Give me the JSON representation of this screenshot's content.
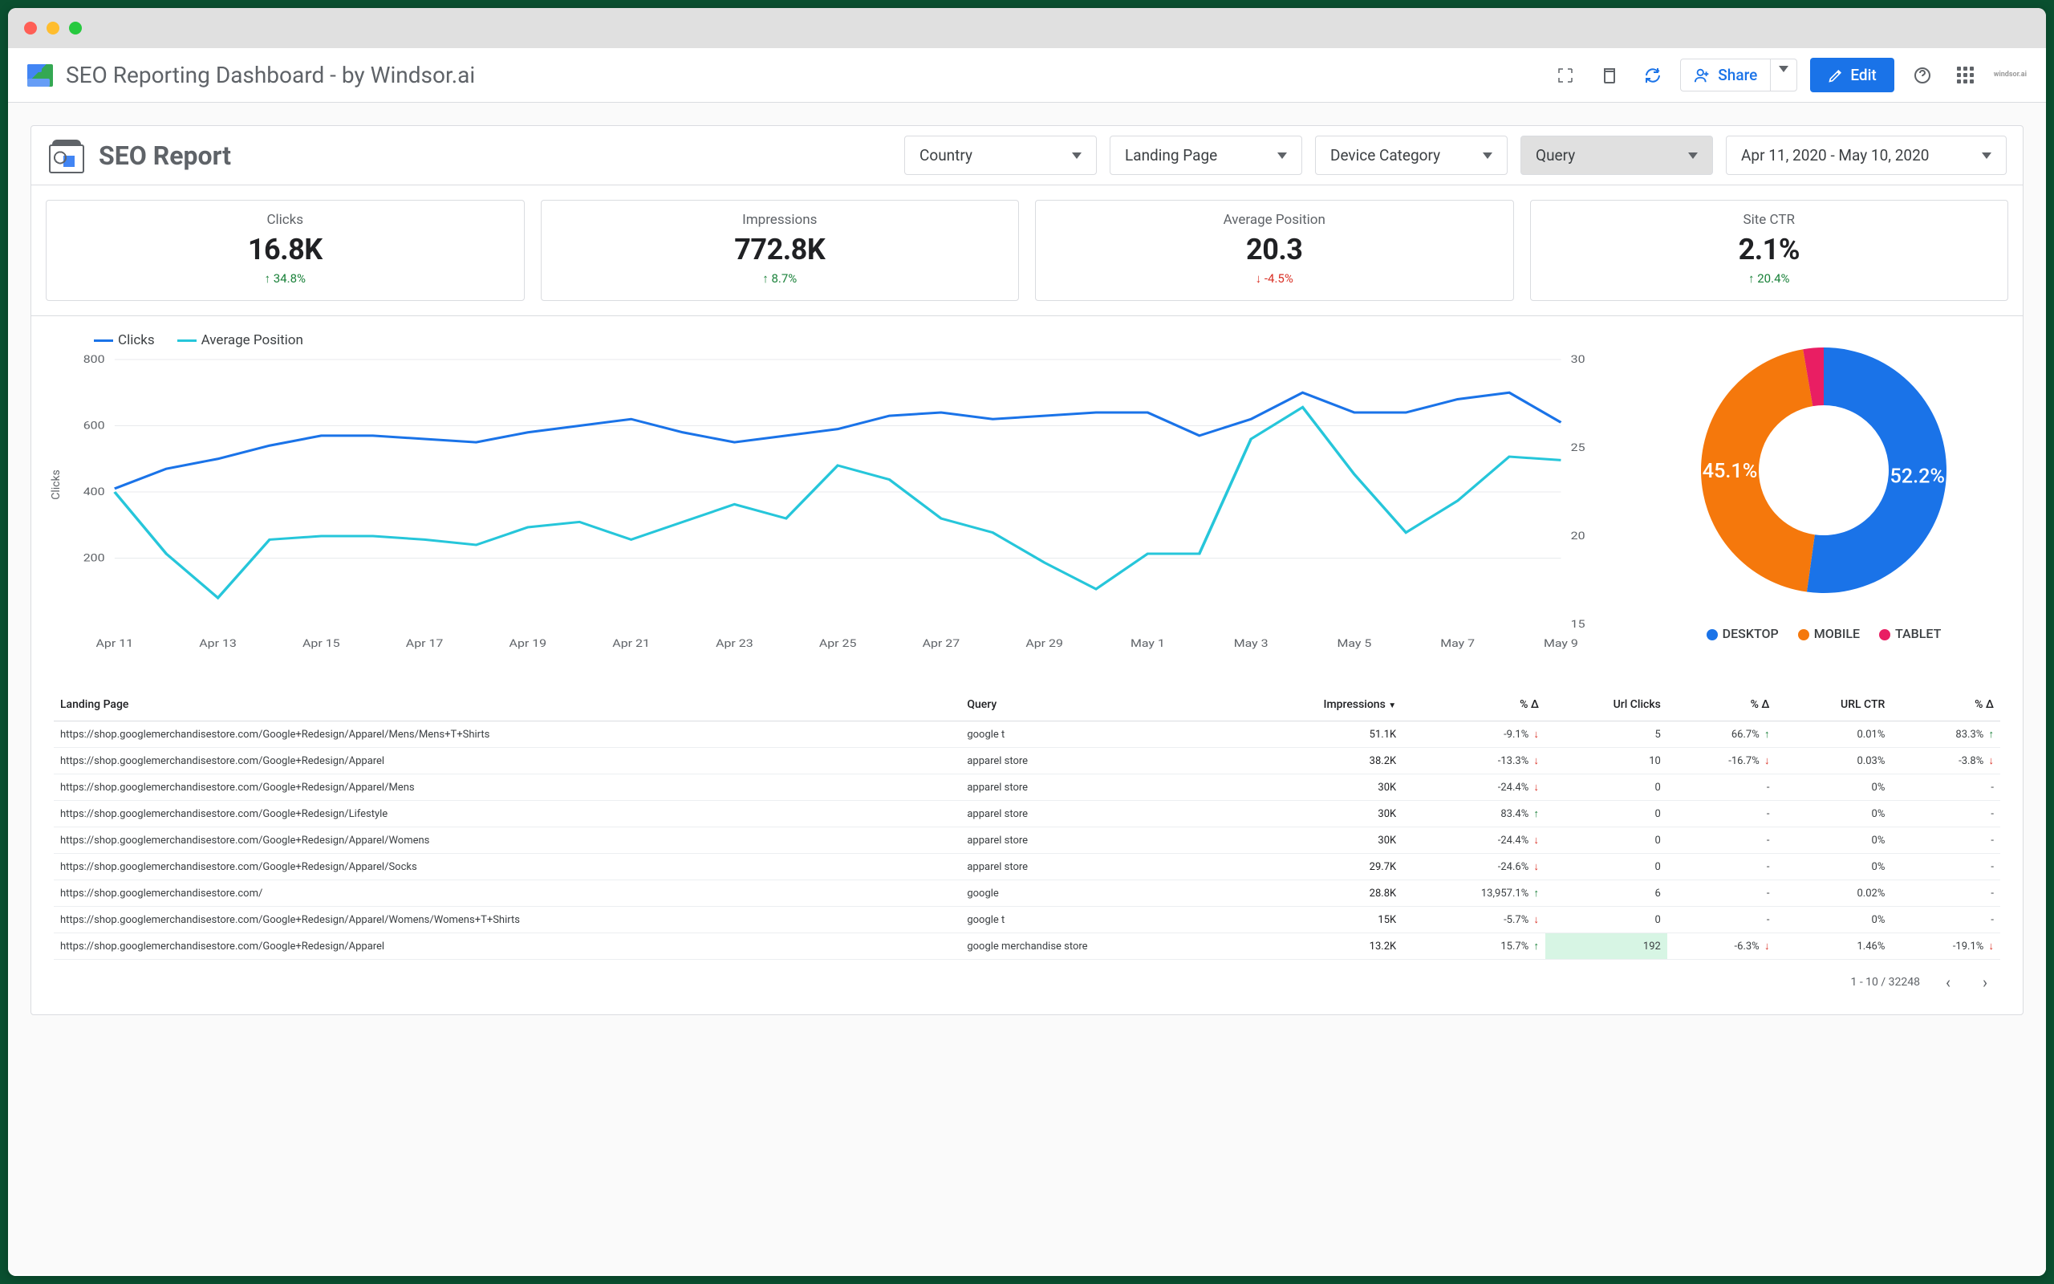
{
  "header": {
    "title": "SEO Reporting Dashboard - by Windsor.ai",
    "share_label": "Share",
    "edit_label": "Edit",
    "brand": "windsor.ai"
  },
  "report": {
    "title": "SEO Report",
    "filters": {
      "country": "Country",
      "landing_page": "Landing Page",
      "device": "Device Category",
      "query": "Query"
    },
    "date_range": "Apr 11, 2020 - May 10, 2020"
  },
  "kpis": [
    {
      "label": "Clicks",
      "value": "16.8K",
      "delta": "34.8%",
      "direction": "up"
    },
    {
      "label": "Impressions",
      "value": "772.8K",
      "delta": "8.7%",
      "direction": "up"
    },
    {
      "label": "Average Position",
      "value": "20.3",
      "delta": "-4.5%",
      "direction": "down"
    },
    {
      "label": "Site CTR",
      "value": "2.1%",
      "delta": "20.4%",
      "direction": "up"
    }
  ],
  "line_legend": {
    "clicks": "Clicks",
    "avg_pos": "Average Position"
  },
  "donut_legend": {
    "desktop": "DESKTOP",
    "mobile": "MOBILE",
    "tablet": "TABLET"
  },
  "table": {
    "columns": [
      "Landing Page",
      "Query",
      "Impressions",
      "% Δ",
      "Url Clicks",
      "% Δ",
      "URL CTR",
      "% Δ"
    ],
    "rows": [
      {
        "lp": "https://shop.googlemerchandisestore.com/Google+Redesign/Apparel/Mens/Mens+T+Shirts",
        "q": "google t",
        "imp": "51.1K",
        "d1": "-9.1%",
        "d1dir": "down",
        "clicks": "5",
        "d2": "66.7%",
        "d2dir": "up",
        "ctr": "0.01%",
        "d3": "83.3%",
        "d3dir": "up",
        "heat": 1.0
      },
      {
        "lp": "https://shop.googlemerchandisestore.com/Google+Redesign/Apparel",
        "q": "apparel store",
        "imp": "38.2K",
        "d1": "-13.3%",
        "d1dir": "down",
        "clicks": "10",
        "d2": "-16.7%",
        "d2dir": "down",
        "ctr": "0.03%",
        "d3": "-3.8%",
        "d3dir": "down",
        "heat": 0.78
      },
      {
        "lp": "https://shop.googlemerchandisestore.com/Google+Redesign/Apparel/Mens",
        "q": "apparel store",
        "imp": "30K",
        "d1": "-24.4%",
        "d1dir": "down",
        "clicks": "0",
        "d2": "-",
        "d2dir": "",
        "ctr": "0%",
        "d3": "-",
        "d3dir": "",
        "heat": 0.62
      },
      {
        "lp": "https://shop.googlemerchandisestore.com/Google+Redesign/Lifestyle",
        "q": "apparel store",
        "imp": "30K",
        "d1": "83.4%",
        "d1dir": "up",
        "clicks": "0",
        "d2": "-",
        "d2dir": "",
        "ctr": "0%",
        "d3": "-",
        "d3dir": "",
        "heat": 0.62
      },
      {
        "lp": "https://shop.googlemerchandisestore.com/Google+Redesign/Apparel/Womens",
        "q": "apparel store",
        "imp": "30K",
        "d1": "-24.4%",
        "d1dir": "down",
        "clicks": "0",
        "d2": "-",
        "d2dir": "",
        "ctr": "0%",
        "d3": "-",
        "d3dir": "",
        "heat": 0.62
      },
      {
        "lp": "https://shop.googlemerchandisestore.com/Google+Redesign/Apparel/Socks",
        "q": "apparel store",
        "imp": "29.7K",
        "d1": "-24.6%",
        "d1dir": "down",
        "clicks": "0",
        "d2": "-",
        "d2dir": "",
        "ctr": "0%",
        "d3": "-",
        "d3dir": "",
        "heat": 0.6
      },
      {
        "lp": "https://shop.googlemerchandisestore.com/",
        "q": "google",
        "imp": "28.8K",
        "d1": "13,957.1%",
        "d1dir": "up",
        "clicks": "6",
        "d2": "-",
        "d2dir": "",
        "ctr": "0.02%",
        "d3": "-",
        "d3dir": "",
        "heat": 0.58
      },
      {
        "lp": "https://shop.googlemerchandisestore.com/Google+Redesign/Apparel/Womens/Womens+T+Shirts",
        "q": "google t",
        "imp": "15K",
        "d1": "-5.7%",
        "d1dir": "down",
        "clicks": "0",
        "d2": "-",
        "d2dir": "",
        "ctr": "0%",
        "d3": "-",
        "d3dir": "",
        "heat": 0.32
      },
      {
        "lp": "https://shop.googlemerchandisestore.com/Google+Redesign/Apparel",
        "q": "google merchandise store",
        "imp": "13.2K",
        "d1": "15.7%",
        "d1dir": "up",
        "clicks": "192",
        "d2": "-6.3%",
        "d2dir": "down",
        "ctr": "1.46%",
        "d3": "-19.1%",
        "d3dir": "down",
        "heat": 0.28
      }
    ],
    "pager": "1 - 10 / 32248"
  },
  "chart_data": [
    {
      "type": "line",
      "id": "clicks_vs_avg_position",
      "x": [
        "Apr 11",
        "Apr 12",
        "Apr 13",
        "Apr 14",
        "Apr 15",
        "Apr 16",
        "Apr 17",
        "Apr 18",
        "Apr 19",
        "Apr 20",
        "Apr 21",
        "Apr 22",
        "Apr 23",
        "Apr 24",
        "Apr 25",
        "Apr 26",
        "Apr 27",
        "Apr 28",
        "Apr 29",
        "Apr 30",
        "May 1",
        "May 2",
        "May 3",
        "May 4",
        "May 5",
        "May 6",
        "May 7",
        "May 8",
        "May 9"
      ],
      "x_ticks": [
        "Apr 11",
        "Apr 13",
        "Apr 15",
        "Apr 17",
        "Apr 19",
        "Apr 21",
        "Apr 23",
        "Apr 25",
        "Apr 27",
        "Apr 29",
        "May 1",
        "May 3",
        "May 5",
        "May 7",
        "May 9"
      ],
      "series": [
        {
          "name": "Clicks",
          "axis": "left",
          "color": "#1a73e8",
          "values": [
            410,
            470,
            500,
            540,
            570,
            570,
            560,
            550,
            580,
            600,
            620,
            580,
            550,
            570,
            590,
            630,
            640,
            620,
            630,
            640,
            640,
            570,
            620,
            700,
            640,
            640,
            680,
            700,
            610
          ]
        },
        {
          "name": "Average Position",
          "axis": "right",
          "color": "#26c6da",
          "values": [
            22.5,
            19.0,
            16.5,
            19.8,
            20.0,
            20.0,
            19.8,
            19.5,
            20.5,
            20.8,
            19.8,
            20.8,
            21.8,
            21.0,
            24.0,
            23.2,
            21.0,
            20.2,
            18.5,
            17.0,
            19.0,
            19.0,
            25.5,
            27.3,
            23.5,
            20.2,
            22.0,
            24.5,
            24.3
          ]
        }
      ],
      "y_left": {
        "label": "Clicks",
        "ticks": [
          200,
          400,
          600,
          800
        ]
      },
      "y_right": {
        "label": "",
        "ticks": [
          15,
          20,
          25,
          30
        ]
      }
    },
    {
      "type": "pie",
      "id": "device_share",
      "slices": [
        {
          "label": "DESKTOP",
          "value": 52.2,
          "color": "#1a73e8"
        },
        {
          "label": "MOBILE",
          "value": 45.1,
          "color": "#f5780c"
        },
        {
          "label": "TABLET",
          "value": 2.7,
          "color": "#e91e63"
        }
      ]
    }
  ]
}
